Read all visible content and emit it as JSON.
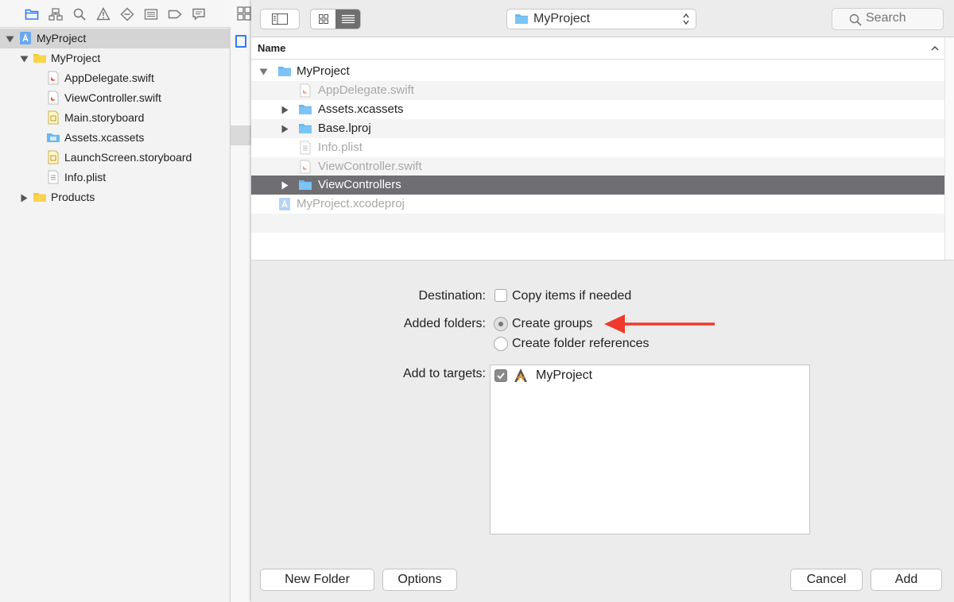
{
  "navigator": {
    "tree": [
      {
        "label": "MyProject",
        "kind": "project",
        "expanded": true,
        "selected": true
      },
      {
        "label": "MyProject",
        "kind": "folder",
        "expanded": true
      },
      {
        "label": "AppDelegate.swift",
        "kind": "swift"
      },
      {
        "label": "ViewController.swift",
        "kind": "swift"
      },
      {
        "label": "Main.storyboard",
        "kind": "storyboard"
      },
      {
        "label": "Assets.xcassets",
        "kind": "xcassets"
      },
      {
        "label": "LaunchScreen.storyboard",
        "kind": "storyboard"
      },
      {
        "label": "Info.plist",
        "kind": "plist"
      },
      {
        "label": "Products",
        "kind": "folder",
        "expanded": false
      }
    ],
    "toolbar_icons": [
      "folder-icon",
      "hierarchy-icon",
      "search-icon",
      "warning-icon",
      "breakpoint-diamond-icon",
      "list-icon",
      "tag-icon",
      "chat-bubble-icon"
    ]
  },
  "dialog": {
    "location": "MyProject",
    "search_placeholder": "Search",
    "column_header": "Name",
    "files": [
      {
        "label": "MyProject",
        "kind": "folder",
        "disclosure": "open",
        "dim": false
      },
      {
        "label": "AppDelegate.swift",
        "kind": "swift",
        "disclosure": "none",
        "dim": true
      },
      {
        "label": "Assets.xcassets",
        "kind": "folder",
        "disclosure": "closed",
        "dim": false
      },
      {
        "label": "Base.lproj",
        "kind": "folder",
        "disclosure": "closed",
        "dim": false
      },
      {
        "label": "Info.plist",
        "kind": "plist",
        "disclosure": "none",
        "dim": true
      },
      {
        "label": "ViewController.swift",
        "kind": "swift",
        "disclosure": "none",
        "dim": true
      },
      {
        "label": "ViewControllers",
        "kind": "folder",
        "disclosure": "closed",
        "dim": false,
        "selected": true
      },
      {
        "label": "MyProject.xcodeproj",
        "kind": "xcodeproj",
        "disclosure": "none",
        "dim": true
      }
    ],
    "options": {
      "destination_label": "Destination:",
      "copy_items_label": "Copy items if needed",
      "copy_items_checked": false,
      "added_folders_label": "Added folders:",
      "create_groups_label": "Create groups",
      "create_folder_refs_label": "Create folder references",
      "selected_folder_option": "Create groups",
      "add_to_targets_label": "Add to targets:",
      "targets": [
        {
          "label": "MyProject",
          "checked": true
        }
      ]
    },
    "buttons": {
      "new_folder": "New Folder",
      "options": "Options",
      "cancel": "Cancel",
      "add": "Add"
    }
  },
  "annotation": {
    "arrow_color": "#f0392c"
  },
  "colors": {
    "selection": "#6f6e72",
    "accent": "#2e7cf6",
    "folder_blue": "#69b8f0",
    "folder_yellow": "#f6c730"
  }
}
